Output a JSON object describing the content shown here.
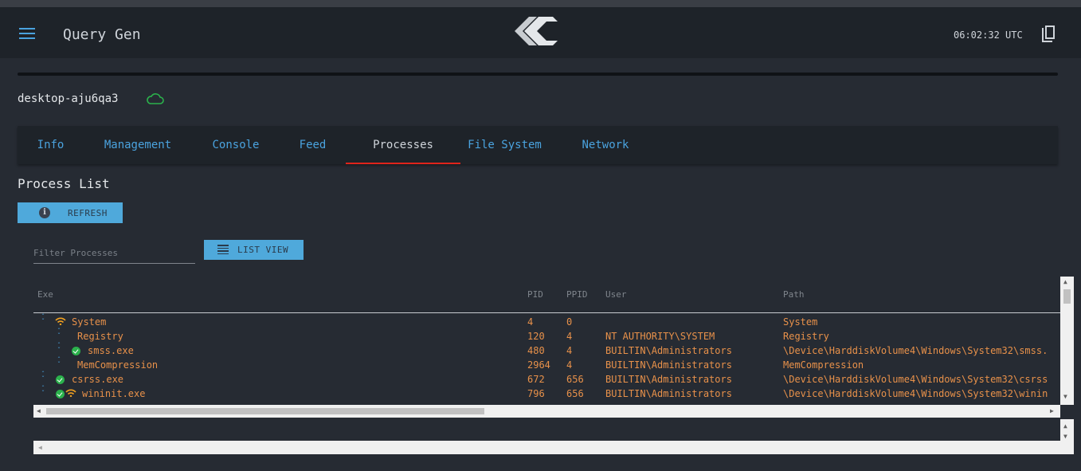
{
  "app": {
    "title": "Query Gen",
    "clock": "06:02:32 UTC",
    "logo": "cc-logo",
    "menu_icon": "hamburger-menu-icon",
    "copy_icon": "copy-icon"
  },
  "host": {
    "name": "desktop-aju6qa3",
    "status_icon": "cloud-icon",
    "status_color": "#2bb24c"
  },
  "tabs": [
    {
      "label": "Info"
    },
    {
      "label": "Management"
    },
    {
      "label": "Console"
    },
    {
      "label": "Feed"
    },
    {
      "label": "Processes",
      "active": true
    },
    {
      "label": "File System"
    },
    {
      "label": "Network"
    }
  ],
  "process_list": {
    "title": "Process List",
    "refresh_label": "REFRESH",
    "filter_placeholder": "Filter Processes",
    "filter_value": "",
    "listview_label": "LIST VIEW",
    "columns": {
      "exe": "Exe",
      "pid": "PID",
      "ppid": "PPID",
      "user": "User",
      "path": "Path"
    },
    "rows": [
      {
        "exe": "System",
        "pid": "4",
        "ppid": "0",
        "user": "",
        "path": "System",
        "icons": [
          "wifi-icon"
        ]
      },
      {
        "exe": "Registry",
        "pid": "120",
        "ppid": "4",
        "user": "NT AUTHORITY\\SYSTEM",
        "path": "Registry",
        "icons": []
      },
      {
        "exe": "smss.exe",
        "pid": "480",
        "ppid": "4",
        "user": "BUILTIN\\Administrators",
        "path": "\\Device\\HarddiskVolume4\\Windows\\System32\\smss.",
        "icons": [
          "check-icon"
        ]
      },
      {
        "exe": "MemCompression",
        "pid": "2964",
        "ppid": "4",
        "user": "BUILTIN\\Administrators",
        "path": "MemCompression",
        "icons": []
      },
      {
        "exe": "csrss.exe",
        "pid": "672",
        "ppid": "656",
        "user": "BUILTIN\\Administrators",
        "path": "\\Device\\HarddiskVolume4\\Windows\\System32\\csrss",
        "icons": [
          "check-icon"
        ]
      },
      {
        "exe": "wininit.exe",
        "pid": "796",
        "ppid": "656",
        "user": "BUILTIN\\Administrators",
        "path": "\\Device\\HarddiskVolume4\\Windows\\System32\\winin",
        "icons": [
          "check-icon",
          "wifi-icon"
        ]
      }
    ]
  },
  "colors": {
    "accent": "#4aa3df",
    "process_text": "#e8914a",
    "active_tab_underline": "#e0241b",
    "button_bg": "#4fa9db",
    "ok": "#2bb24c",
    "wifi": "#f0a020"
  }
}
